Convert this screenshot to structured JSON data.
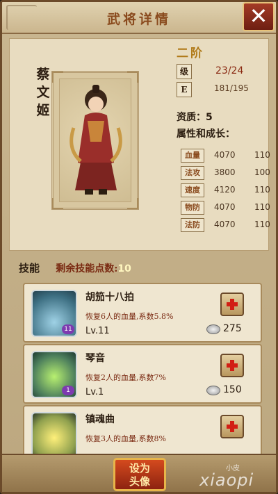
{
  "header": {
    "title": "武将详情",
    "close_glyph": "✕"
  },
  "hero": {
    "name_chars": [
      "蔡",
      "文",
      "姬"
    ],
    "rank": "二阶",
    "level_tag": "级",
    "level_value": "23/24",
    "exp_tag": "E",
    "exp_value": "181/195",
    "aptitude_label": "资质：",
    "aptitude_value": "5",
    "attr_title": "属性和成长："
  },
  "attributes": [
    {
      "name": "血量",
      "value": "4070",
      "growth": "110"
    },
    {
      "name": "法攻",
      "value": "3800",
      "growth": "100"
    },
    {
      "name": "速度",
      "value": "4120",
      "growth": "110"
    },
    {
      "name": "物防",
      "value": "4070",
      "growth": "110"
    },
    {
      "name": "法防",
      "value": "4070",
      "growth": "110"
    }
  ],
  "skills_section": {
    "label": "技能",
    "points_label": "剩余技能点数:",
    "points_value": "10"
  },
  "skills": [
    {
      "name": "胡笳十八拍",
      "desc": "恢复6人的血量,系数5.8%",
      "level": "Lv.11",
      "badge": "11",
      "cost": "275",
      "icon": "blue-water-skill-icon"
    },
    {
      "name": "琴音",
      "desc": "恢复2人的血量,系数7%",
      "level": "Lv.1",
      "badge": "1",
      "cost": "150",
      "icon": "green-sparkle-skill-icon"
    },
    {
      "name": "镇魂曲",
      "desc": "恢复3人的血量,系数8%",
      "level": "",
      "badge": "",
      "cost": "",
      "icon": "yellow-glow-skill-icon"
    }
  ],
  "footer": {
    "set_avatar_line1": "设为",
    "set_avatar_line2": "头像",
    "watermark_small": "小皮",
    "watermark_big": "xiaopi"
  },
  "colors": {
    "accent": "#8a4b1e",
    "frame": "#6b4a2a",
    "plus": "#d21e14"
  }
}
